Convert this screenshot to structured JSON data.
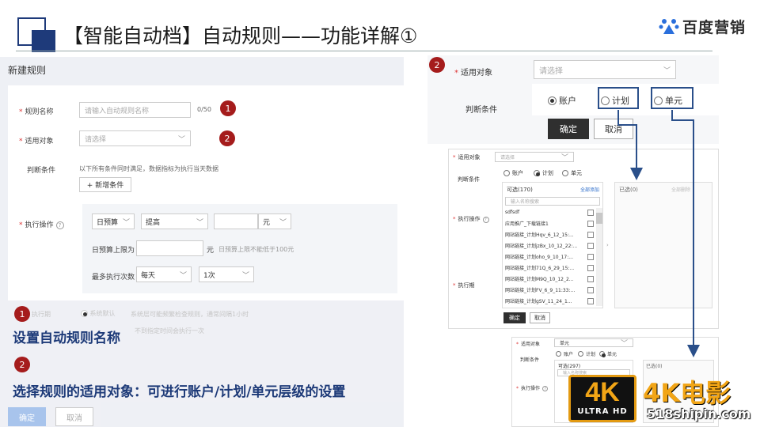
{
  "slide": {
    "title": "【智能自动档】自动规则——功能详解①",
    "brand": "百度营销"
  },
  "form": {
    "header": "新建规则",
    "rule_name_label": "规则名称",
    "rule_name_placeholder": "请输入自动规则名称",
    "rule_name_count": "0/50",
    "target_label": "适用对象",
    "target_placeholder": "请选择",
    "condition_label": "判断条件",
    "condition_desc": "以下所有条件同时满足，数据指标为执行当天数据",
    "add_condition": "+ 新增条件",
    "action_label": "执行操作",
    "action_budget_select": "日预算",
    "action_change_select": "提高",
    "action_unit_select": "元",
    "budget_cap_label": "日预算上限为",
    "budget_cap_unit": "元",
    "budget_cap_hint": "日预算上限不能低于100元",
    "max_exec_label": "最多执行次数",
    "max_exec_freq": "每天",
    "max_exec_times": "1次",
    "exec_cycle_label": "执行期",
    "exec_cycle_option": "系统默认",
    "exec_cycle_hint": "系统层可能频繁检查规则，通常间隔1小时",
    "exec_cycle_hint2": "不到指定时间会执行一次",
    "confirm": "确定",
    "cancel": "取消",
    "required_mark": "*"
  },
  "callouts": [
    {
      "num": "1",
      "text": "设置自动规则名称"
    },
    {
      "num": "2",
      "text": "选择规则的适用对象：可进行账户/计划/单元层级的设置"
    }
  ],
  "panel1": {
    "badge": "2",
    "target_label": "适用对象",
    "target_placeholder": "请选择",
    "condition_label": "判断条件",
    "radio_account": "账户",
    "radio_plan": "计划",
    "radio_unit": "单元",
    "confirm": "确定",
    "cancel": "取消"
  },
  "panel2": {
    "target_label": "适用对象",
    "target_placeholder": "请选择",
    "condition_label": "判断条件",
    "radio_account": "账户",
    "radio_plan": "计划",
    "radio_unit": "单元",
    "available_label": "可选(170)",
    "add_all": "全部添加",
    "selected_label": "已选(0)",
    "remove_all": "全部删除",
    "search_placeholder": "输入名称搜索",
    "action_label": "执行操作",
    "exec_label": "执行期",
    "items": [
      "sdfsdf",
      "应用推广_下载链接1",
      "网站链接_计划Hqv_6_12_15:...",
      "网站链接_计划jzBx_10_12_22:...",
      "网站链接_计划oho_9_10_17:...",
      "网站链接_计划71Q_6_29_15:...",
      "网站链接_计划M9Q_10_12_2...",
      "网站链接_计划FV_6_9_11:33:...",
      "网站链接_计划gSV_11_24_1..."
    ],
    "confirm": "确定",
    "cancel": "取消"
  },
  "panel3": {
    "target_label": "适用对象",
    "target_value": "单元",
    "condition_label": "判断条件",
    "radio_account": "账户",
    "radio_plan": "计划",
    "radio_unit": "单元",
    "available_label": "可选(297)",
    "selected_label": "已选(0)",
    "search_placeholder": "输入名称搜索",
    "action_label": "执行操作"
  },
  "watermark": {
    "badge_big": "4K",
    "badge_small": "ULTRA HD",
    "title": "4K电影",
    "url": "518shipin.com"
  },
  "colors": {
    "accent_dark_blue": "#1d3a78",
    "badge_red": "#a51c1c",
    "highlight_blue": "#2a4f8a"
  }
}
